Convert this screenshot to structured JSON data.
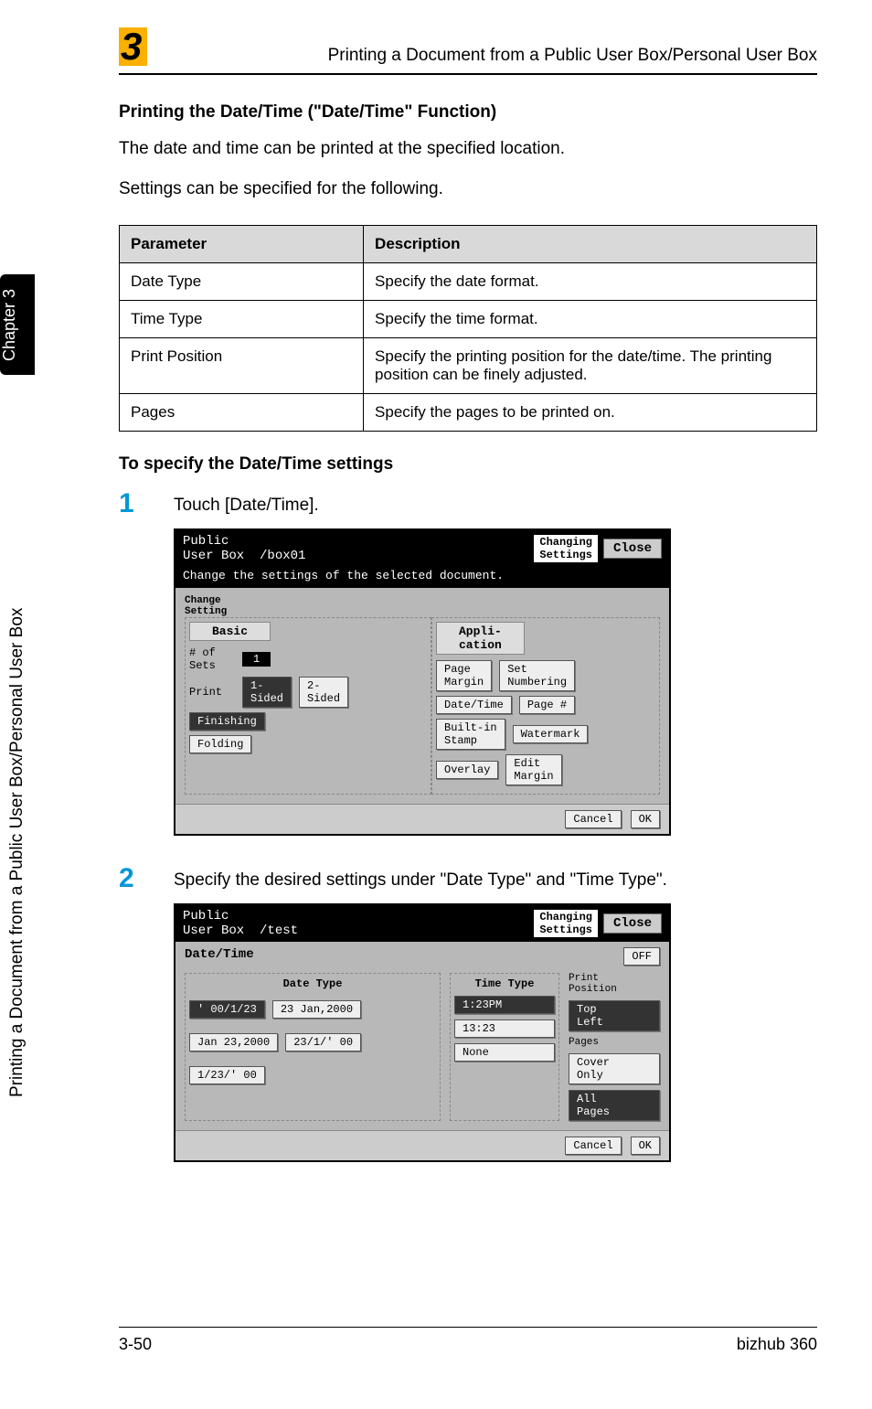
{
  "chapter_number": "3",
  "header_title": "Printing a Document from a Public User Box/Personal User Box",
  "side_tab": "Chapter 3",
  "side_text": "Printing a Document from a Public User Box/Personal User Box",
  "heading": "Printing the Date/Time (\"Date/Time\" Function)",
  "body1": "The date and time can be printed at the specified location.",
  "body2": "Settings can be specified for the following.",
  "table": {
    "col1": "Parameter",
    "col2": "Description",
    "rows": [
      {
        "p": "Date Type",
        "d": "Specify the date format."
      },
      {
        "p": "Time Type",
        "d": "Specify the time format."
      },
      {
        "p": "Print Position",
        "d": "Specify the printing position for the date/time. The printing position can be finely adjusted."
      },
      {
        "p": "Pages",
        "d": "Specify the pages to be printed on."
      }
    ]
  },
  "sub_heading": "To specify the Date/Time settings",
  "steps": {
    "s1": {
      "num": "1",
      "text": "Touch [Date/Time]."
    },
    "s2": {
      "num": "2",
      "text": "Specify the desired settings under \"Date Type\" and \"Time Type\"."
    }
  },
  "screen1": {
    "hdr_left": "Public\nUser Box  /box01",
    "hdr_tag": "Changing\nSettings",
    "hdr_close": "Close",
    "sub": "Change the settings of the selected document.",
    "change_setting": "Change\nSetting",
    "tab_basic": "Basic",
    "tab_appli": "Appli-\ncation",
    "sets_lbl": "# of\nSets",
    "sets_val": "1",
    "page_margin": "Page\nMargin",
    "set_numbering": "Set\nNumbering",
    "print_lbl": "Print",
    "sided1": "1-\nSided",
    "sided2": "2-\nSided",
    "date_time": "Date/Time",
    "page_no": "Page #",
    "finishing": "Finishing",
    "builtin": "Built-in\nStamp",
    "watermark": "Watermark",
    "folding": "Folding",
    "overlay": "Overlay",
    "edit_margin": "Edit\nMargin",
    "cancel": "Cancel",
    "ok": "OK"
  },
  "screen2": {
    "hdr_left": "Public\nUser Box  /test",
    "hdr_tag": "Changing\nSettings",
    "hdr_close": "Close",
    "title": "Date/Time",
    "off": "OFF",
    "date_type": "Date Type",
    "time_type": "Time Type",
    "print_pos": "Print\nPosition",
    "top_left": "Top\nLeft",
    "pages": "Pages",
    "cover_only": "Cover\nOnly",
    "all_pages": "All\nPages",
    "d1": "' 00/1/23",
    "d2": "23 Jan,2000",
    "d3": "Jan 23,2000",
    "d4": "23/1/' 00",
    "d5": "1/23/' 00",
    "t1": "1:23PM",
    "t2": "13:23",
    "t3": "None",
    "cancel": "Cancel",
    "ok": "OK"
  },
  "footer": {
    "left": "3-50",
    "right": "bizhub 360"
  }
}
